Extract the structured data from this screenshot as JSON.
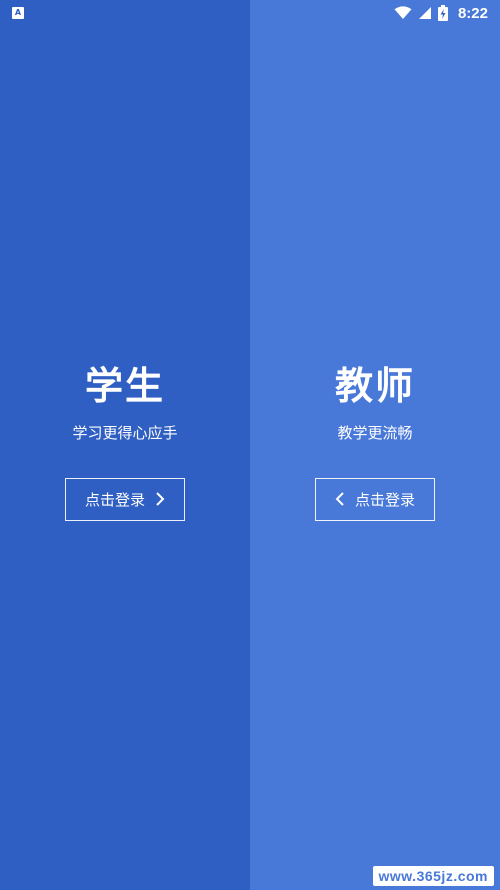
{
  "status_bar": {
    "notification_letter": "A",
    "time": "8:22",
    "icons": [
      "wifi-icon",
      "signal-icon",
      "battery-charging-icon"
    ]
  },
  "student": {
    "title": "学生",
    "subtitle": "学习更得心应手",
    "button_label": "点击登录",
    "panel_color": "#2f5fc2"
  },
  "teacher": {
    "title": "教师",
    "subtitle": "教学更流畅",
    "button_label": "点击登录",
    "panel_color": "#4878d8"
  },
  "watermark": "www.365jz.com"
}
